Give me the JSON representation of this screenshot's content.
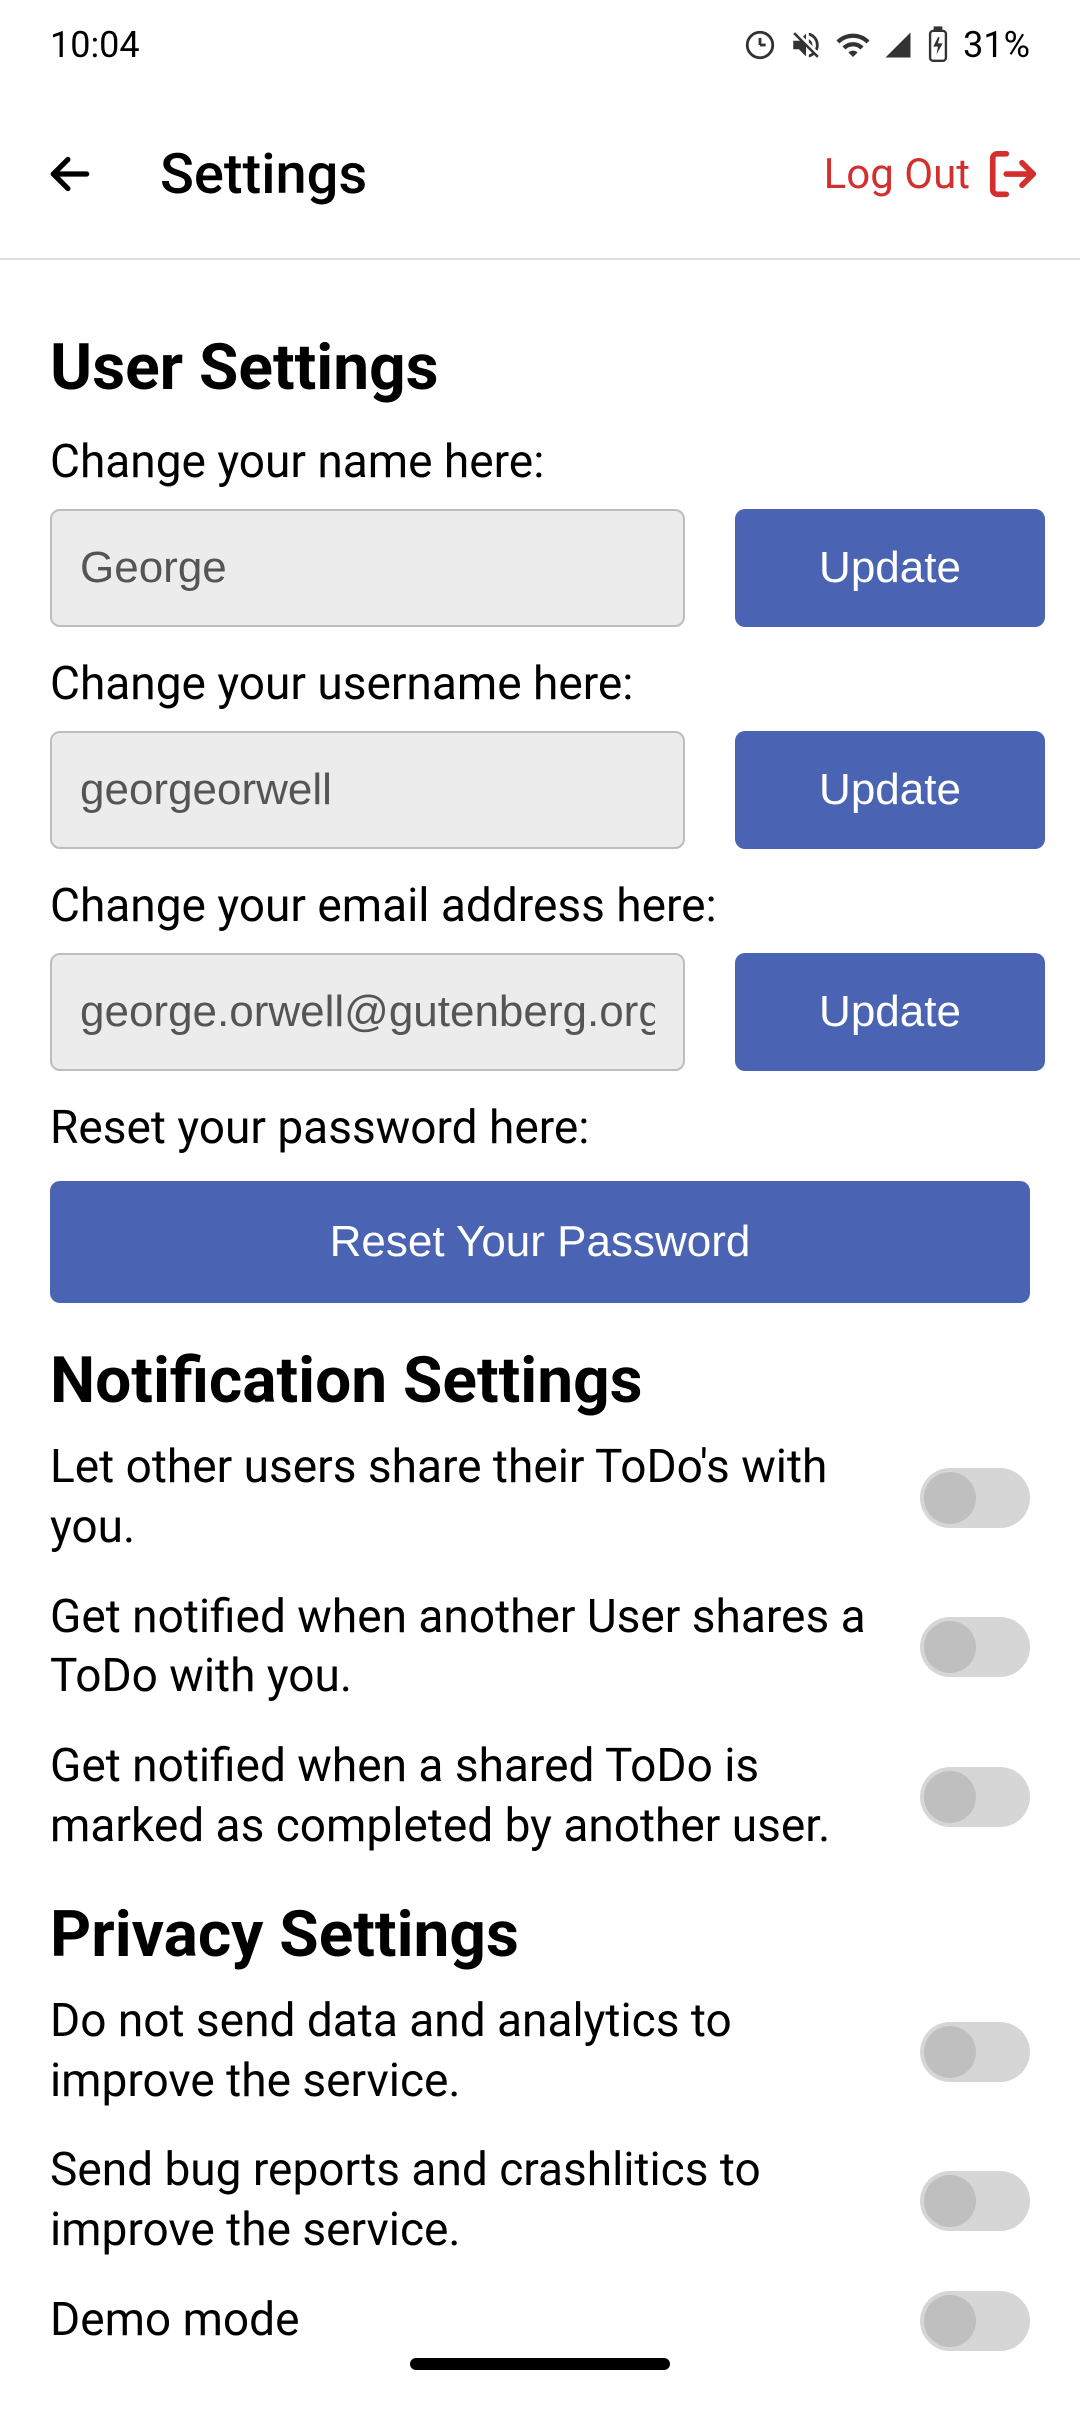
{
  "status": {
    "time": "10:04",
    "battery": "31%"
  },
  "header": {
    "title": "Settings",
    "logout": "Log Out"
  },
  "user_settings": {
    "title": "User Settings",
    "name_label": "Change your name here:",
    "name_value": "George",
    "name_update": "Update",
    "username_label": "Change your username here:",
    "username_value": "georgeorwell",
    "username_update": "Update",
    "email_label": "Change your email address here:",
    "email_value": "george.orwell@gutenberg.org",
    "email_update": "Update",
    "password_label": "Reset your password here:",
    "password_button": "Reset Your Password"
  },
  "notification_settings": {
    "title": "Notification Settings",
    "share_label": "Let other users share their ToDo's with you.",
    "share_on": false,
    "notify_share_label": "Get notified when another User shares a ToDo with you.",
    "notify_share_on": false,
    "notify_complete_label": "Get notified when a shared ToDo is marked as completed by another user.",
    "notify_complete_on": false
  },
  "privacy_settings": {
    "title": "Privacy Settings",
    "analytics_label": "Do not send data and analytics to improve the service.",
    "analytics_on": false,
    "bugreport_label": "Send bug reports and crashlitics to improve the service.",
    "bugreport_on": false,
    "demo_label": "Demo mode"
  }
}
